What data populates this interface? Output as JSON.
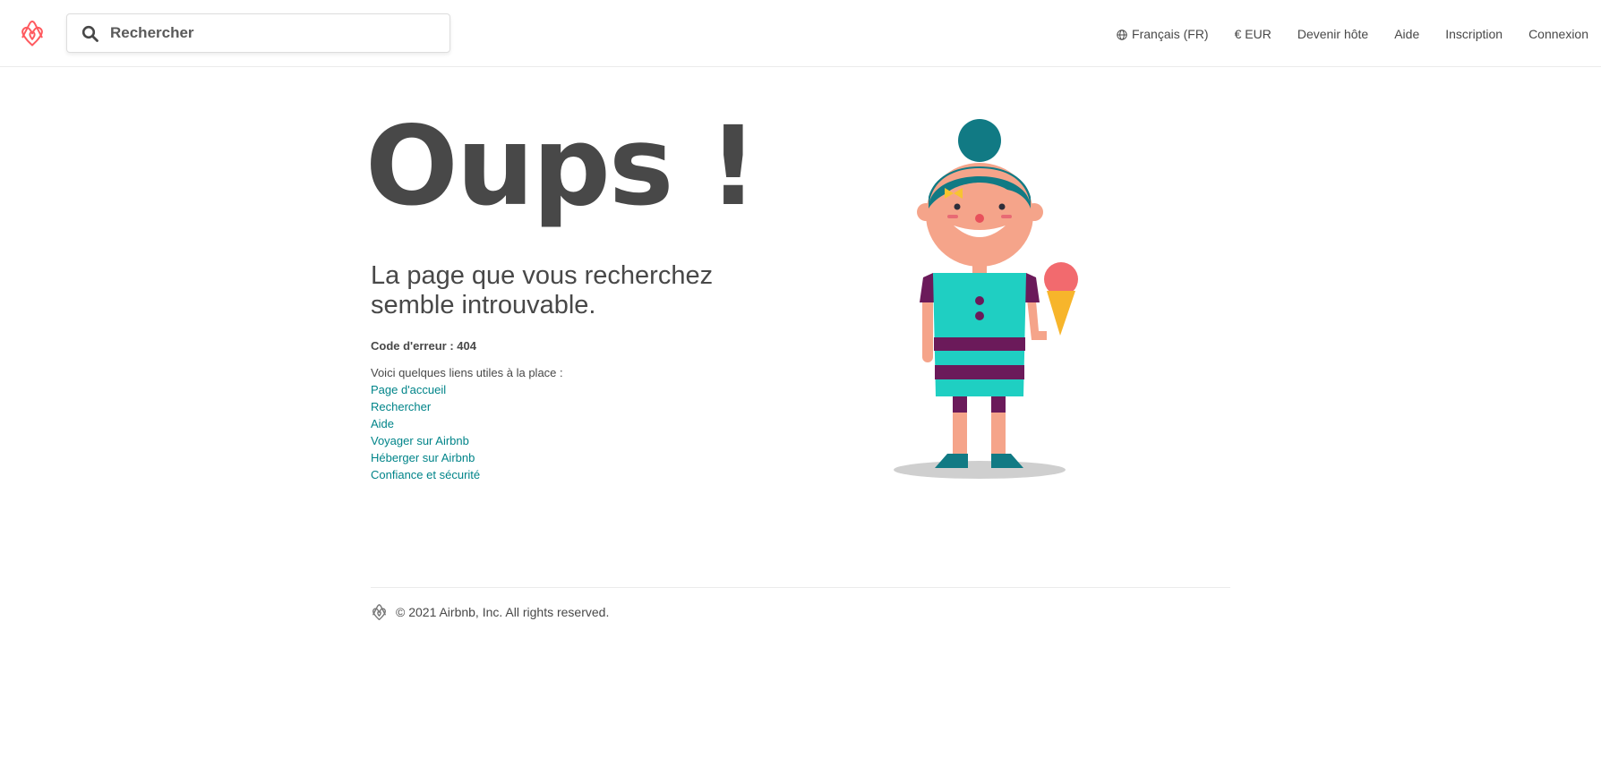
{
  "header": {
    "logo_icon": "airbnb-belo-icon",
    "search": {
      "icon": "search-icon",
      "placeholder": "Rechercher",
      "value": ""
    },
    "nav": {
      "language": {
        "icon": "globe-icon",
        "label": "Français (FR)"
      },
      "currency": "€ EUR",
      "become_host": "Devenir hôte",
      "help": "Aide",
      "signup": "Inscription",
      "login": "Connexion"
    }
  },
  "main": {
    "title": "Oups !",
    "subtitle": "La page que vous recherchez semble introuvable.",
    "error_code": "Code d'erreur : 404",
    "links_intro": "Voici quelques liens utiles à la place :",
    "links": [
      "Page d'accueil",
      "Rechercher",
      "Aide",
      "Voyager sur Airbnb",
      "Héberger sur Airbnb",
      "Confiance et sécurité"
    ],
    "illustration": "girl-with-ice-cream-illustration"
  },
  "footer": {
    "logo_icon": "airbnb-belo-icon",
    "copyright": "© 2021 Airbnb, Inc. All rights reserved."
  },
  "colors": {
    "brand": "#FF5A5F",
    "link": "#008489",
    "text": "#484848",
    "divider": "#EBEBEB"
  }
}
